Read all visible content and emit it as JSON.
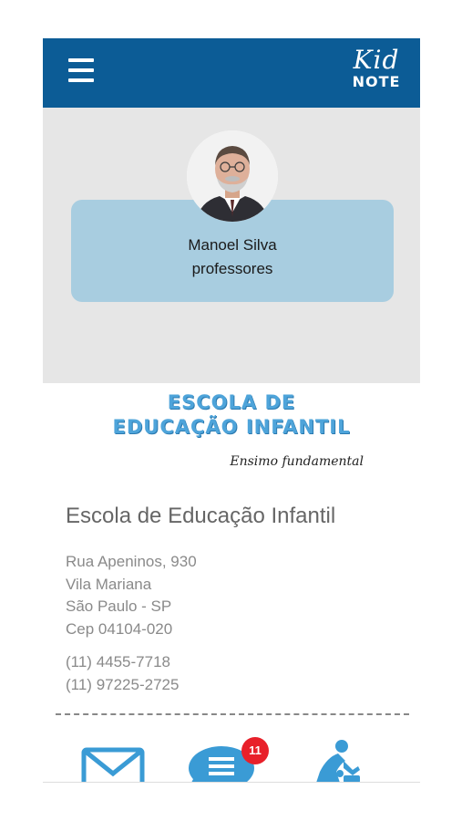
{
  "app": {
    "logo_line1": "Kid",
    "logo_line2": "NOTE",
    "header_color": "#0c5c96",
    "menu_icon": "hamburger-menu-icon"
  },
  "profile": {
    "name": "Manoel Silva",
    "role": "professores",
    "avatar_icon": "user-avatar-photo",
    "card_color": "#a8cde0"
  },
  "school": {
    "logo_line1": "ESCOLA DE",
    "logo_line2": "EDUCAÇÃO INFANTIL",
    "logo_tagline": "Ensimo fundamental",
    "name": "Escola de Educação Infantil",
    "address": [
      "Rua Apeninos, 930",
      "Vila Mariana",
      "São Paulo - SP",
      "Cep 04104-020"
    ],
    "phones": [
      "(11) 4455-7718",
      "(11) 97225-2725"
    ],
    "accent_color": "#4ea4da"
  },
  "bottom_nav": {
    "items": [
      {
        "icon": "mail-icon"
      },
      {
        "icon": "chat-icon",
        "badge": "11"
      },
      {
        "icon": "activity-icon"
      }
    ],
    "badge_color": "#e8202a"
  }
}
